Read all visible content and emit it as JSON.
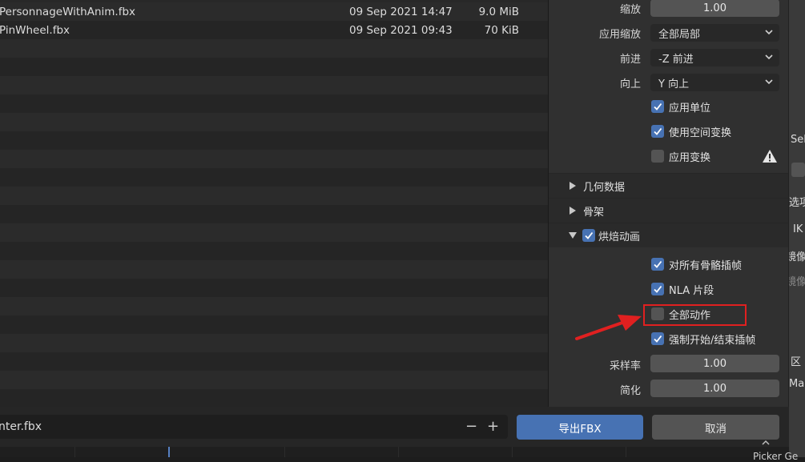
{
  "file_list": [
    {
      "name": "PersonnageWithAnim.fbx",
      "date": "09 Sep 2021 14:47",
      "size": "9.0 MiB"
    },
    {
      "name": "PinWheel.fbx",
      "date": "09 Sep 2021 09:43",
      "size": "70 KiB"
    }
  ],
  "transform": {
    "scale_label": "缩放",
    "scale_value": "1.00",
    "apply_scalings_label": "应用缩放",
    "apply_scalings_value": "全部局部",
    "forward_label": "前进",
    "forward_value": "-Z 前进",
    "up_label": "向上",
    "up_value": "Y 向上",
    "apply_unit": {
      "label": "应用单位",
      "checked": true
    },
    "use_space_transform": {
      "label": "使用空间变换",
      "checked": true
    },
    "apply_transform": {
      "label": "应用变换",
      "checked": false
    }
  },
  "sections": {
    "geometry": "几何数据",
    "armature": "骨架",
    "bake_animation": {
      "label": "烘焙动画",
      "checked": true,
      "expanded": true
    }
  },
  "bake_anim": {
    "key_all_bones": {
      "label": "对所有骨骼插帧",
      "checked": true
    },
    "nla_strips": {
      "label": "NLA 片段",
      "checked": true
    },
    "all_actions": {
      "label": "全部动作",
      "checked": false
    },
    "force_start_end": {
      "label": "强制开始/结束插帧",
      "checked": true
    },
    "sampling_rate_label": "采样率",
    "sampling_rate_value": "1.00",
    "simplify_label": "简化",
    "simplify_value": "1.00"
  },
  "bottom_bar": {
    "filename": "nter.fbx",
    "decrement": "−",
    "increment": "+",
    "export_label": "导出FBX",
    "cancel_label": "取消"
  },
  "right_editor_fragments": {
    "sel": "Sel",
    "xuan": "选项",
    "ik": "IK",
    "jing1": "镜像",
    "jing2": "镜像",
    "qu": "区",
    "ma": "Ma",
    "picker": "Picker Ge"
  },
  "colors": {
    "accent": "#4772b3",
    "annotation": "#e02020"
  },
  "icons": {
    "warning": "warning-icon",
    "checkmark": "checkmark-icon",
    "dropdown": "chevron-down-icon",
    "collapsed": "triangle-right-icon",
    "expanded": "triangle-down-icon"
  }
}
